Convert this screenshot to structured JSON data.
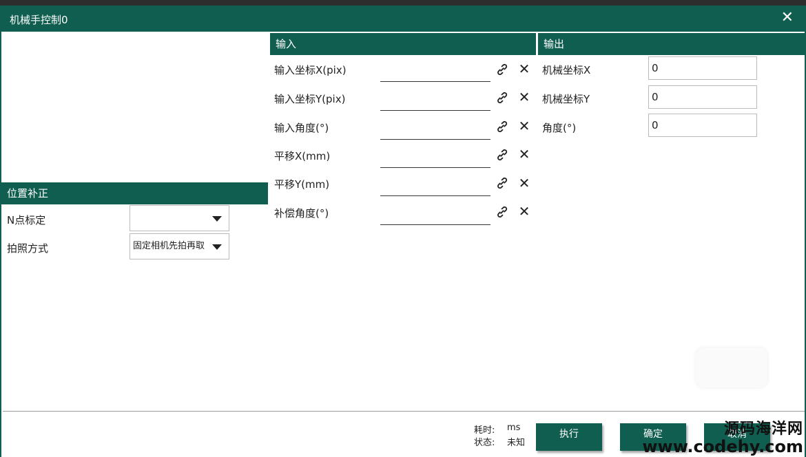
{
  "window": {
    "title": "机械手控制0"
  },
  "input_section": {
    "header": "输入",
    "rows": [
      {
        "label": "输入坐标X(pix)",
        "value": ""
      },
      {
        "label": "输入坐标Y(pix)",
        "value": ""
      },
      {
        "label": "输入角度(°)",
        "value": ""
      },
      {
        "label": "平移X(mm)",
        "value": ""
      },
      {
        "label": "平移Y(mm)",
        "value": ""
      },
      {
        "label": "补偿角度(°)",
        "value": ""
      }
    ]
  },
  "output_section": {
    "header": "输出",
    "rows": [
      {
        "label": "机械坐标X",
        "value": "0"
      },
      {
        "label": "机械坐标Y",
        "value": "0"
      },
      {
        "label": "角度(°)",
        "value": "0"
      }
    ]
  },
  "position_section": {
    "header": "位置补正",
    "rows": [
      {
        "label": "N点标定",
        "value": ""
      },
      {
        "label": "拍照方式",
        "value": "固定相机先拍再取"
      }
    ]
  },
  "status": {
    "time_label": "耗时:",
    "time_value": "ms",
    "state_label": "状态:",
    "state_value": "未知"
  },
  "buttons": {
    "execute": "执行",
    "confirm": "确定",
    "cancel": "取消"
  },
  "watermark": {
    "line1": "源码海洋网",
    "line2": "www.codehy.com"
  },
  "icons": {
    "link": "link-icon",
    "clear": "close-icon",
    "dropdown": "triangle-down-icon"
  },
  "colors": {
    "accent": "#0f5e50"
  }
}
